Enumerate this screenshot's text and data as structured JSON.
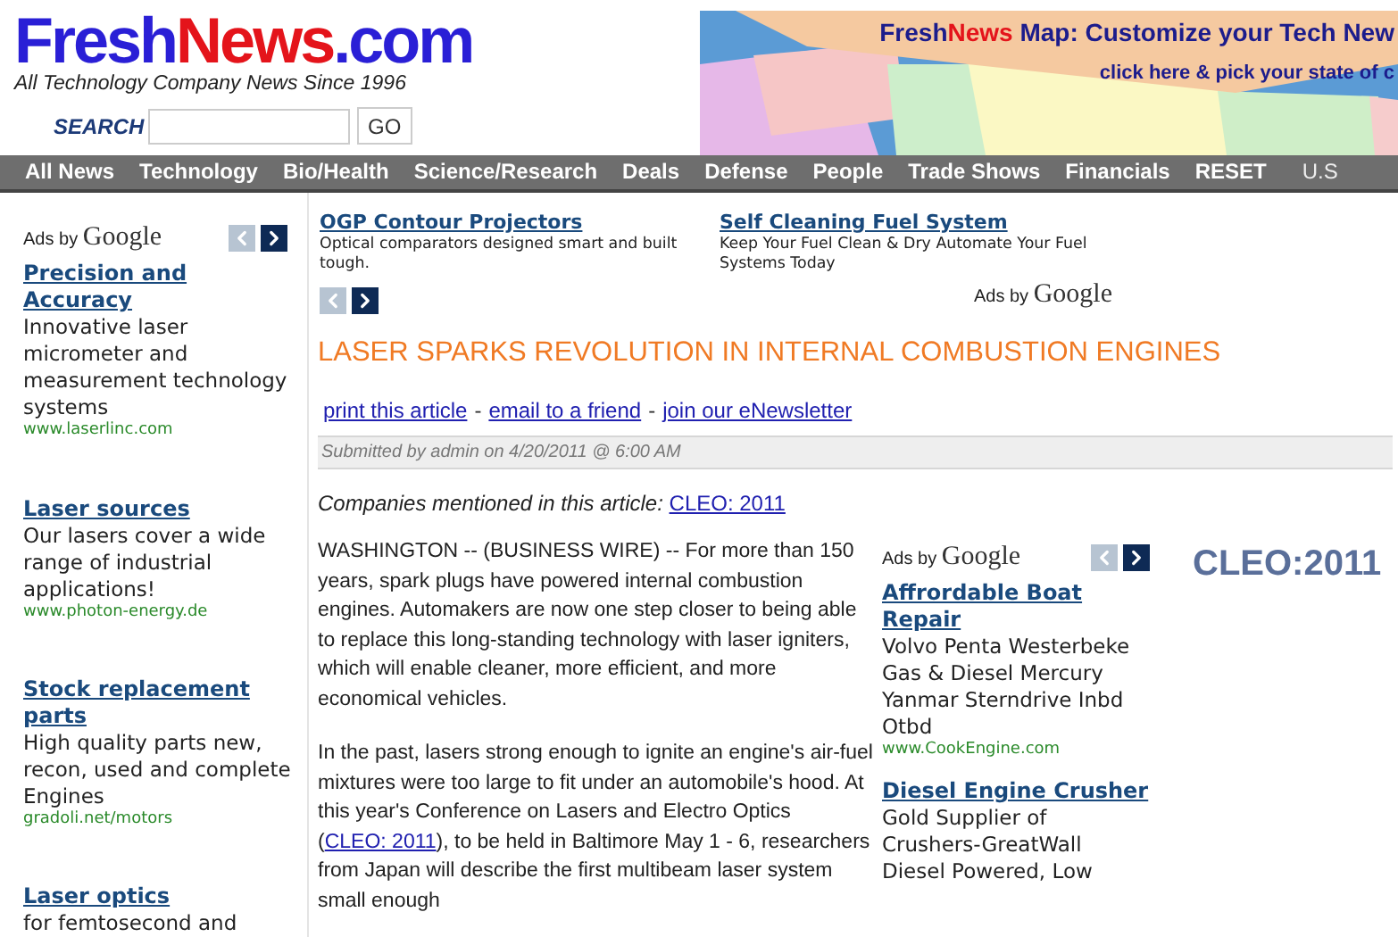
{
  "logo": {
    "parts": [
      {
        "text": "Fresh",
        "color": "#2a1fd6"
      },
      {
        "text": "News",
        "color": "#e4141b"
      },
      {
        "text": ".com",
        "color": "#2a1fd6"
      }
    ],
    "tagline": "All Technology Company News Since 1996"
  },
  "search": {
    "label": "SEARCH",
    "button": "GO"
  },
  "banner": {
    "title_parts": [
      {
        "text": "Fresh",
        "color": "#1c1c8c"
      },
      {
        "text": "News",
        "color": "#e4141b"
      },
      {
        "text": " Map:  Customize your Tech New",
        "color": "#1c1c8c"
      }
    ],
    "subtitle": "click here & pick your state of c"
  },
  "nav": [
    "All News",
    "Technology",
    "Bio/Health",
    "Science/Research",
    "Deals",
    "Defense",
    "People",
    "Trade Shows",
    "Financials",
    "RESET",
    "U.S"
  ],
  "sidebar_ads": {
    "label": {
      "prefix": "Ads by",
      "brand": "Google"
    },
    "ads": [
      {
        "title": "Precision and Accuracy",
        "text": "Innovative laser micrometer and measurement technology systems",
        "url": "www.laserlinc.com"
      },
      {
        "title": "Laser sources",
        "text": "Our lasers cover a wide range of industrial applications!",
        "url": "www.photon-energy.de"
      },
      {
        "title": "Stock replacement parts",
        "text": "High quality parts new, recon, used and complete Engines",
        "url": "gradoli.net/motors"
      },
      {
        "title": "Laser optics",
        "text": "for femtosecond and"
      }
    ]
  },
  "top_ads": {
    "label": {
      "prefix": "Ads by",
      "brand": "Google"
    },
    "ads": [
      {
        "title": "OGP Contour Projectors",
        "text": "Optical comparators designed smart and built tough."
      },
      {
        "title": "Self Cleaning Fuel System",
        "text": "Keep Your Fuel Clean & Dry Automate Your Fuel Systems Today"
      }
    ]
  },
  "article": {
    "title": "LASER SPARKS REVOLUTION IN INTERNAL COMBUSTION ENGINES",
    "actions": [
      "print this article",
      "email to a friend",
      "join our eNewsletter"
    ],
    "action_separator": "-",
    "submitted": "Submitted by admin on 4/20/2011 @ 6:00 AM",
    "companies_label": "Companies mentioned in this article:",
    "companies_link": "CLEO: 2011",
    "paragraphs": [
      [
        {
          "text": "WASHINGTON -- (BUSINESS WIRE) -- For more than 150 years, spark plugs have powered internal combustion engines. Automakers are now one step closer to being able to replace this long-standing technology with laser igniters, which will enable cleaner, more efficient, and more economical vehicles."
        }
      ],
      [
        {
          "text": "In the past, lasers strong enough to ignite an engine's air-fuel mixtures were too large to fit under an automobile's hood. At this year's Conference on Lasers and Electro Optics ("
        },
        {
          "text": "CLEO: 2011",
          "link": true
        },
        {
          "text": "), to be held in Baltimore May 1 - 6, researchers from Japan will describe the first multibeam laser system small enough"
        }
      ]
    ]
  },
  "inline_ads": {
    "label": {
      "prefix": "Ads by",
      "brand": "Google"
    },
    "ads": [
      {
        "title": "Affrordable Boat Repair",
        "text": "Volvo Penta Westerbeke Gas & Diesel Mercury Yanmar Sterndrive Inbd Otbd",
        "url": "www.CookEngine.com"
      },
      {
        "title": "Diesel Engine Crusher",
        "text": "Gold Supplier of Crushers-GreatWall Diesel Powered, Low"
      }
    ]
  },
  "cleo_logo": "CLEO:2011"
}
